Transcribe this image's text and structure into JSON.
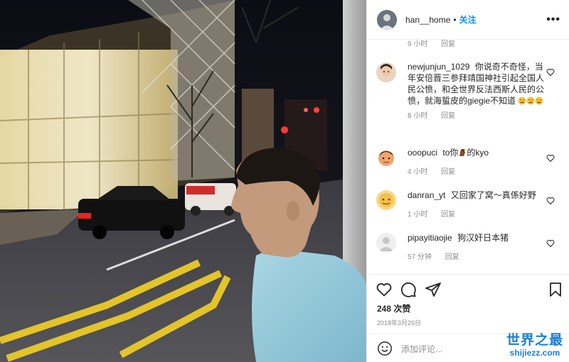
{
  "post": {
    "username": "han__home",
    "follow_label": "关注",
    "more_label": "•••",
    "separator": "•"
  },
  "top_meta": {
    "time": "9 小时",
    "reply": "回复"
  },
  "comments": [
    {
      "username": "newjunjun_1029",
      "text": "你说奇不奇怪，当年安倍晋三参拜靖国神社引起全国人民公愤，和全世界反法西斯人民的公愤，就海蜇皮的giegie不知道",
      "emoji": [
        "tired-face-emoji",
        "tired-face-emoji",
        "tired-face-emoji"
      ],
      "time": "8 小时",
      "reply": "回复"
    },
    {
      "username": "ooopuci",
      "text_before": "to你",
      "emoji": [
        "horse-emoji"
      ],
      "text_after": "的kyo",
      "time": "4 小时",
      "reply": "回复"
    },
    {
      "username": "danran_yt",
      "text": "又回家了窝～真係好野",
      "time": "1 小时",
      "reply": "回复"
    },
    {
      "username": "pipayitiaojie",
      "text": "狗汉奸日本猪",
      "time": "57 分钟",
      "reply": "回复"
    }
  ],
  "likes": "248 次赞",
  "date": "2018年3月29日",
  "add_comment": {
    "placeholder": "添加评论..."
  },
  "watermark": {
    "line1": "世界之最",
    "line2": "shijiezz.com"
  },
  "colors": {
    "accent": "#0095f6",
    "watermark": "#1a7fd4",
    "photo_shirt": "#8fc6d8"
  },
  "icons": [
    "more-icon",
    "heart-icon",
    "comment-icon",
    "share-icon",
    "bookmark-icon",
    "smiley-icon"
  ]
}
